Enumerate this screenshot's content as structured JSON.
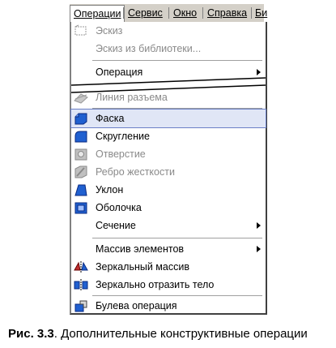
{
  "menubar": {
    "items": [
      "Операции",
      "Сервис",
      "Окно",
      "Справка",
      "Би"
    ]
  },
  "menu": {
    "items": [
      {
        "label": "Эскиз",
        "disabled": true,
        "icon": "sketch-icon"
      },
      {
        "label": "Эскиз из библиотеки...",
        "disabled": true,
        "icon": ""
      },
      {
        "label": "Операция",
        "disabled": false,
        "icon": "",
        "submenu": true
      },
      {
        "label": "Линия разъема",
        "disabled": true,
        "icon": "parting-line-icon"
      },
      {
        "label": "Фаска",
        "disabled": false,
        "icon": "chamfer-icon",
        "highlighted": true
      },
      {
        "label": "Скругление",
        "disabled": false,
        "icon": "fillet-icon"
      },
      {
        "label": "Отверстие",
        "disabled": true,
        "icon": "hole-icon"
      },
      {
        "label": "Ребро жесткости",
        "disabled": true,
        "icon": "rib-icon"
      },
      {
        "label": "Уклон",
        "disabled": false,
        "icon": "draft-icon"
      },
      {
        "label": "Оболочка",
        "disabled": false,
        "icon": "shell-icon"
      },
      {
        "label": "Сечение",
        "disabled": false,
        "icon": "",
        "submenu": true
      },
      {
        "label": "Массив элементов",
        "disabled": false,
        "icon": "",
        "submenu": true
      },
      {
        "label": "Зеркальный массив",
        "disabled": false,
        "icon": "mirror-array-icon"
      },
      {
        "label": "Зеркально отразить тело",
        "disabled": false,
        "icon": "mirror-body-icon"
      },
      {
        "label": "Булева операция",
        "disabled": false,
        "icon": "boolean-icon"
      }
    ]
  },
  "caption": {
    "figure": "Рис. 3.3",
    "text": ". Дополнительные конструктивные операции"
  }
}
